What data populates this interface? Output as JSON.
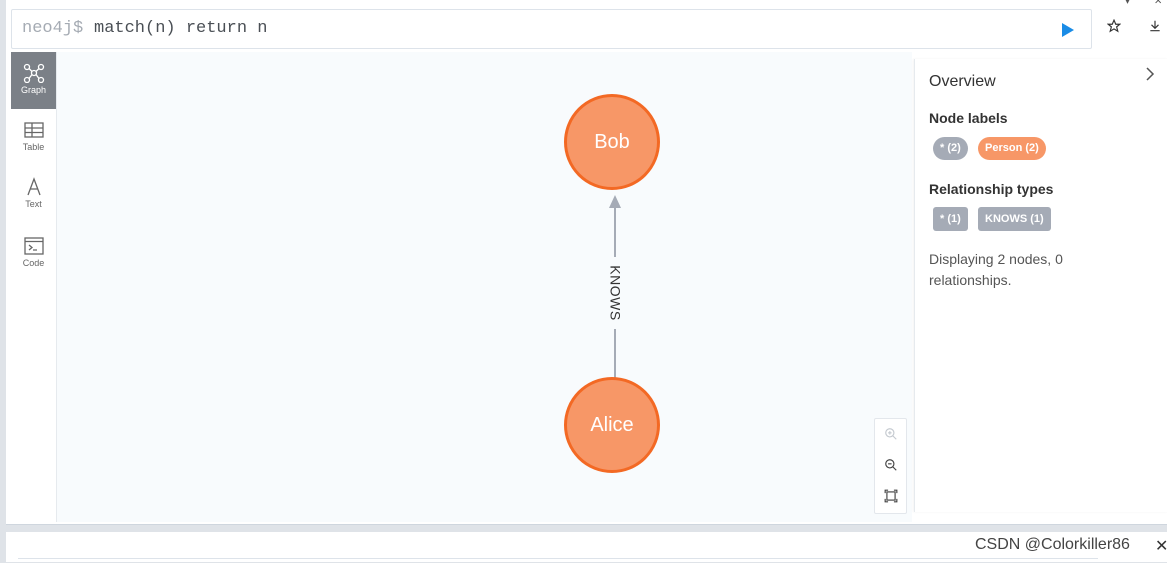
{
  "editor": {
    "prompt": "neo4j$",
    "query": "match(n) return n"
  },
  "sidebar": {
    "items": [
      {
        "label": "Graph",
        "icon": "graph-icon",
        "active": true
      },
      {
        "label": "Table",
        "icon": "table-icon"
      },
      {
        "label": "Text",
        "icon": "text-icon"
      },
      {
        "label": "Code",
        "icon": "code-icon"
      }
    ]
  },
  "graph": {
    "nodes": [
      {
        "label": "Bob",
        "color": "#f79767"
      },
      {
        "label": "Alice",
        "color": "#f79767"
      }
    ],
    "relationship": {
      "type": "KNOWS",
      "from": "Alice",
      "to": "Bob"
    }
  },
  "overview": {
    "title": "Overview",
    "node_labels_heading": "Node labels",
    "node_labels": [
      "* (2)",
      "Person (2)"
    ],
    "rel_types_heading": "Relationship types",
    "rel_types": [
      "* (1)",
      "KNOWS (1)"
    ],
    "summary": "Displaying 2 nodes, 0 relationships."
  },
  "watermark": "CSDN @Colorkiller86"
}
